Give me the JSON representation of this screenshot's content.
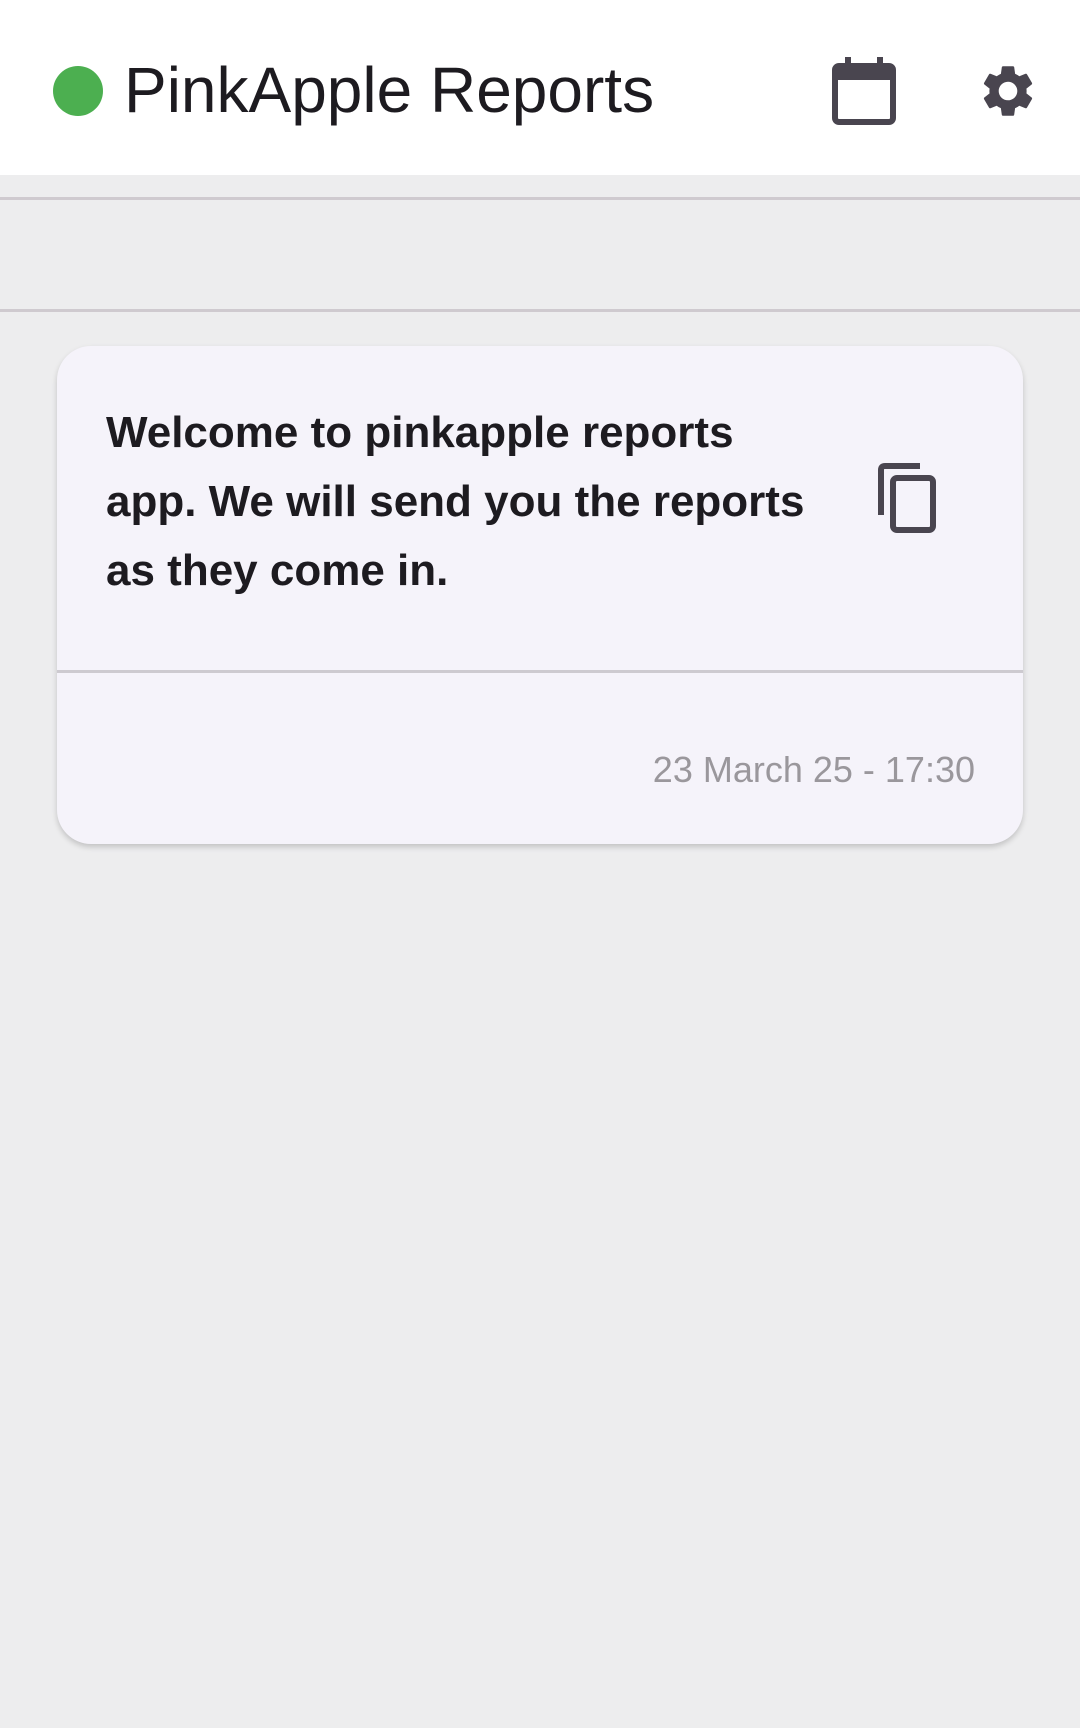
{
  "header": {
    "title": "PinkApple Reports",
    "status_color": "#4caf50",
    "icons": {
      "status": "status-dot",
      "calendar": "calendar-icon",
      "settings": "gear-icon"
    }
  },
  "filter_strip": {},
  "reports": [
    {
      "message": "Welcome to pinkapple reports app. We will send you the reports as they come in.",
      "timestamp": "23 March 25 - 17:30",
      "icon": "copy-icon"
    }
  ],
  "colors": {
    "background": "#ededee",
    "card": "#f5f3fa",
    "text": "#1d1b20",
    "icon": "#49454f",
    "muted": "#9a979c"
  }
}
